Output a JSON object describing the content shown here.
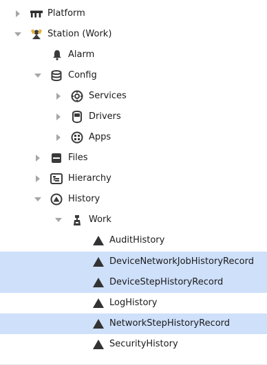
{
  "tree": {
    "nodes": [
      {
        "label": "Platform",
        "icon": "platform-icon",
        "expanded": false,
        "selected": false
      },
      {
        "label": "Station (Work)",
        "icon": "station-icon",
        "expanded": true,
        "selected": false
      },
      {
        "label": "Alarm",
        "icon": "bell-icon",
        "expanded": null,
        "selected": false
      },
      {
        "label": "Config",
        "icon": "database-icon",
        "expanded": true,
        "selected": false
      },
      {
        "label": "Services",
        "icon": "services-gear-icon",
        "expanded": false,
        "selected": false
      },
      {
        "label": "Drivers",
        "icon": "drivers-icon",
        "expanded": false,
        "selected": false
      },
      {
        "label": "Apps",
        "icon": "apps-grid-icon",
        "expanded": false,
        "selected": false
      },
      {
        "label": "Files",
        "icon": "files-icon",
        "expanded": false,
        "selected": false
      },
      {
        "label": "Hierarchy",
        "icon": "hierarchy-icon",
        "expanded": false,
        "selected": false
      },
      {
        "label": "History",
        "icon": "history-icon",
        "expanded": true,
        "selected": false
      },
      {
        "label": "Work",
        "icon": "work-device-icon",
        "expanded": true,
        "selected": false
      },
      {
        "label": "AuditHistory",
        "icon": "history-record-icon",
        "expanded": null,
        "selected": false
      },
      {
        "label": "DeviceNetworkJobHistoryRecord",
        "icon": "history-record-icon",
        "expanded": null,
        "selected": true
      },
      {
        "label": "DeviceStepHistoryRecord",
        "icon": "history-record-icon",
        "expanded": null,
        "selected": true
      },
      {
        "label": "LogHistory",
        "icon": "history-record-icon",
        "expanded": null,
        "selected": false
      },
      {
        "label": "NetworkStepHistoryRecord",
        "icon": "history-record-icon",
        "expanded": null,
        "selected": true
      },
      {
        "label": "SecurityHistory",
        "icon": "history-record-icon",
        "expanded": null,
        "selected": false
      }
    ]
  },
  "colors": {
    "selection": "#cfe0fb",
    "arrow": "#a6a6a6",
    "icon": "#3a3a3a"
  }
}
